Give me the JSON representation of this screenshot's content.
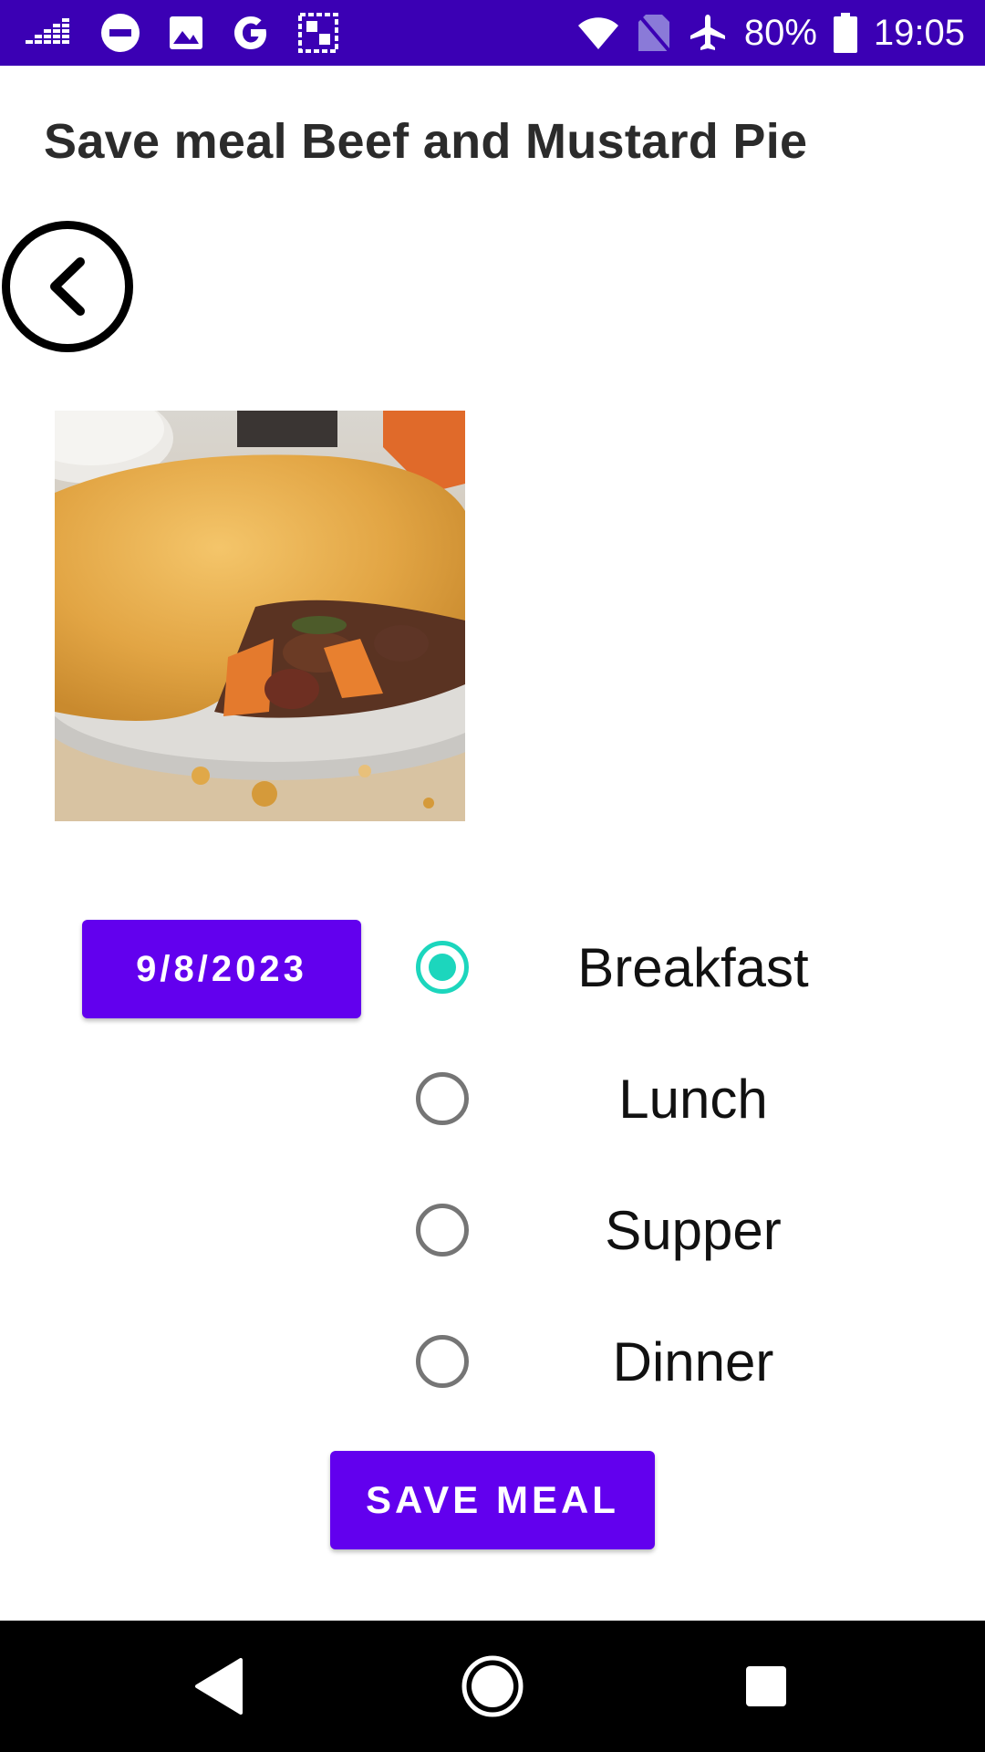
{
  "status_bar": {
    "battery": "80%",
    "time": "19:05",
    "icons": [
      "signal-bars-icon",
      "do-not-disturb-icon",
      "image-icon",
      "google-icon",
      "app-notification-icon",
      "wifi-icon",
      "no-sim-icon",
      "airplane-mode-icon",
      "battery-icon"
    ]
  },
  "page": {
    "title": "Save meal Beef and Mustard Pie"
  },
  "form": {
    "date_label": "9/8/2023",
    "meal_options": [
      {
        "label": "Breakfast",
        "checked": true
      },
      {
        "label": "Lunch",
        "checked": false
      },
      {
        "label": "Supper",
        "checked": false
      },
      {
        "label": "Dinner",
        "checked": false
      }
    ],
    "save_label": "SAVE MEAL"
  },
  "colors": {
    "status_bar": "#3b00b4",
    "button": "#6200ee",
    "radio_checked": "#1cd6bd",
    "radio_unchecked": "#757575"
  }
}
